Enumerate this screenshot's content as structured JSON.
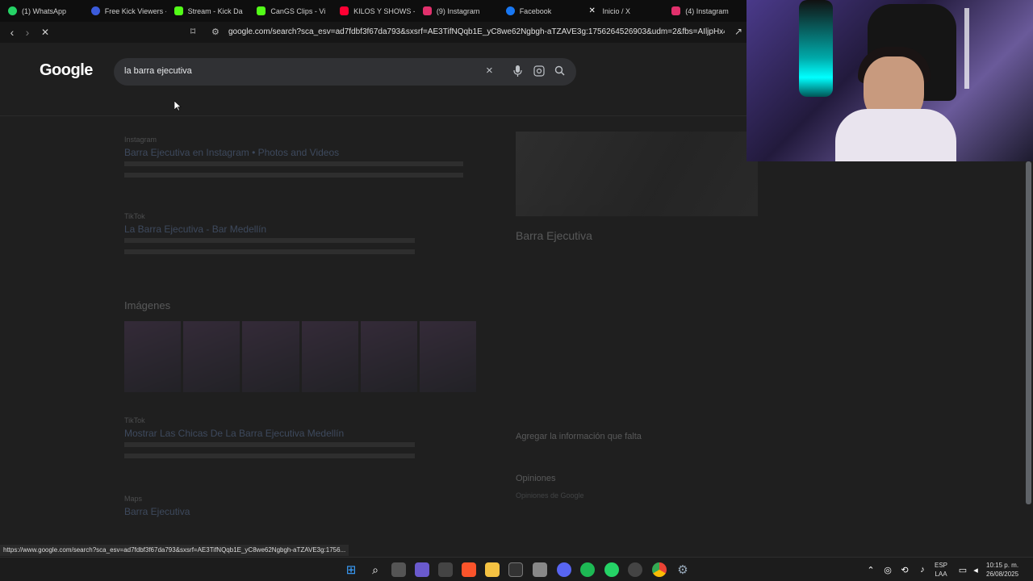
{
  "browser": {
    "tabs": [
      {
        "label": "(1) WhatsApp",
        "color": "#25d366"
      },
      {
        "label": "Free Kick Viewers -",
        "color": "#3b5bdb"
      },
      {
        "label": "Stream - Kick Da",
        "color": "#53fc18"
      },
      {
        "label": "CanGS Clips - Vi",
        "color": "#53fc18"
      },
      {
        "label": "KILOS Y SHOWS - Li",
        "color": "#ff0033"
      },
      {
        "label": "(9) Instagram",
        "color": "#e1306c"
      },
      {
        "label": "Facebook",
        "color": "#1877f2"
      },
      {
        "label": "Inicio / X",
        "color": "#ffffff"
      },
      {
        "label": "(4) Instagram",
        "color": "#e1306c"
      }
    ],
    "url": "google.com/search?sca_esv=ad7fdbf3f67da793&sxsrf=AE3TifNQqb1E_yC8we62Ngbgh-aTZAVE3g:1756264526903&udm=2&fbs=AIljpHx4nJjfGojPV...",
    "status_url": "https://www.google.com/search?sca_esv=ad7fdbf3f67da793&sxsrf=AE3TifNQqb1E_yC8we62Ngbgh-aTZAVE3g:1756..."
  },
  "google": {
    "logo": "Google",
    "query": "la barra ejecutiva"
  },
  "results": [
    {
      "source": "Instagram",
      "title": "Barra Ejecutiva en Instagram • Photos and Videos"
    },
    {
      "source": "TikTok",
      "title": "La Barra Ejecutiva - Bar Medellín"
    },
    {
      "source": "TikTok",
      "title": "Mostrar Las Chicas De La Barra Ejecutiva Medellín"
    },
    {
      "source": "Maps",
      "title": "Barra Ejecutiva"
    }
  ],
  "images_label": "Imágenes",
  "knowledge_panel": {
    "title": "Barra Ejecutiva",
    "add_info": "Agregar la información que falta",
    "opinions": "Opiniones",
    "opinions_google": "Opiniones de Google"
  },
  "taskbar": {
    "lang_top": "ESP",
    "lang_bottom": "LAA",
    "time": "10:15 p. m.",
    "date": "26/08/2025"
  }
}
